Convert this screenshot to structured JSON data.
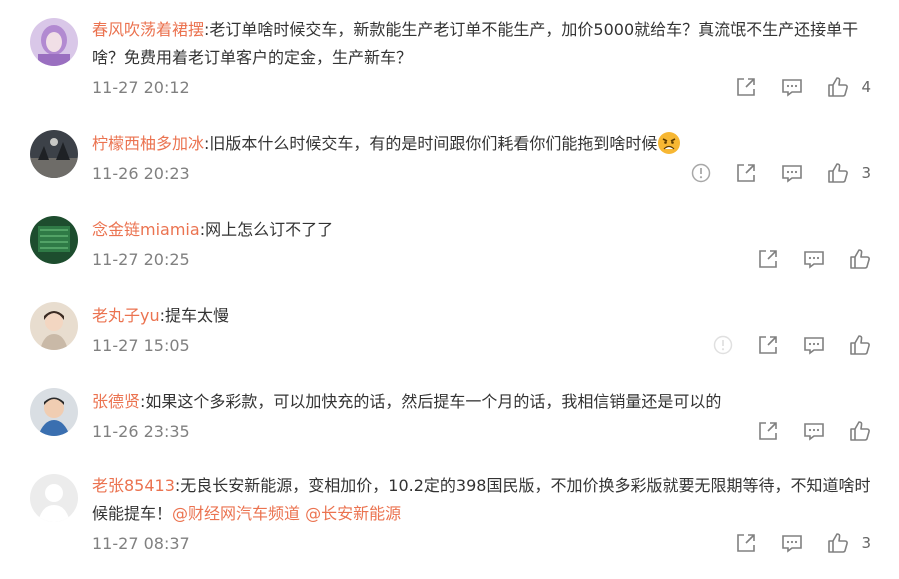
{
  "comments": [
    {
      "user": "春风吹荡着裙摆",
      "text": "老订单啥时候交车，新款能生产老订单不能生产，加价5000就给车？真流氓不生产还接单干啥？免费用着老订单客户的定金，生产新车？",
      "time": "11-27 20:12",
      "likes": "4"
    },
    {
      "user": "柠檬西柚多加冰",
      "text": "旧版本什么时候交车，有的是时间跟你们耗看你们能拖到啥时候",
      "emoji": "angry-face-emoji",
      "time": "11-26 20:23",
      "likes": "3"
    },
    {
      "user": "念金链miamia",
      "text": "网上怎么订不了了",
      "time": "11-27 20:25",
      "likes": ""
    },
    {
      "user": "老丸子yu",
      "text": "提车太慢",
      "time": "11-27 15:05",
      "likes": ""
    },
    {
      "user": "张德贤",
      "text": "如果这个多彩款，可以加快充的话，然后提车一个月的话，我相信销量还是可以的",
      "time": "11-26 23:35",
      "likes": ""
    },
    {
      "user": "老张85413",
      "text": "无良长安新能源，变相加价，10.2定的398国民版，不加价换多彩版就要无限期等待，不知道啥时候能提车！",
      "mentions": [
        "@财经网汽车频道",
        "@长安新能源"
      ],
      "time": "11-27 08:37",
      "likes": "3"
    }
  ],
  "icons": {
    "share": "share-icon",
    "comment": "comment-icon",
    "like": "thumbs-up-icon",
    "report": "report-icon"
  },
  "colors": {
    "username": "#eb7350",
    "text": "#333333",
    "timestamp": "#808080",
    "icon": "#808080"
  }
}
